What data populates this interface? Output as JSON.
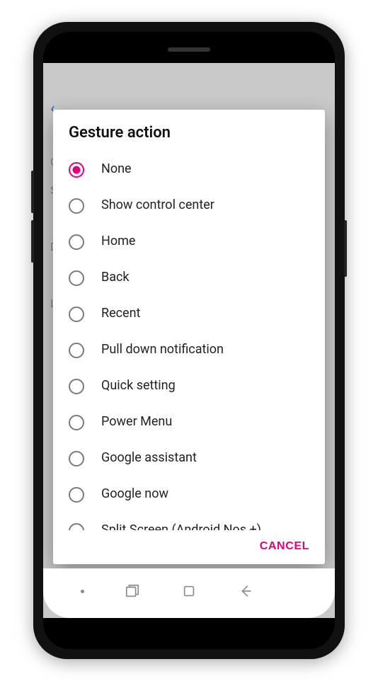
{
  "dialog": {
    "title": "Gesture action",
    "options": [
      {
        "label": "None",
        "selected": true
      },
      {
        "label": "Show control center",
        "selected": false
      },
      {
        "label": "Home",
        "selected": false
      },
      {
        "label": "Back",
        "selected": false
      },
      {
        "label": "Recent",
        "selected": false
      },
      {
        "label": "Pull down notification",
        "selected": false
      },
      {
        "label": "Quick setting",
        "selected": false
      },
      {
        "label": "Power Menu",
        "selected": false
      },
      {
        "label": "Google assistant",
        "selected": false
      },
      {
        "label": "Google now",
        "selected": false
      },
      {
        "label": "Split Screen (Android Nos +)",
        "selected": false
      }
    ],
    "cancel_label": "CANCEL"
  },
  "colors": {
    "accent": "#e6007a"
  }
}
